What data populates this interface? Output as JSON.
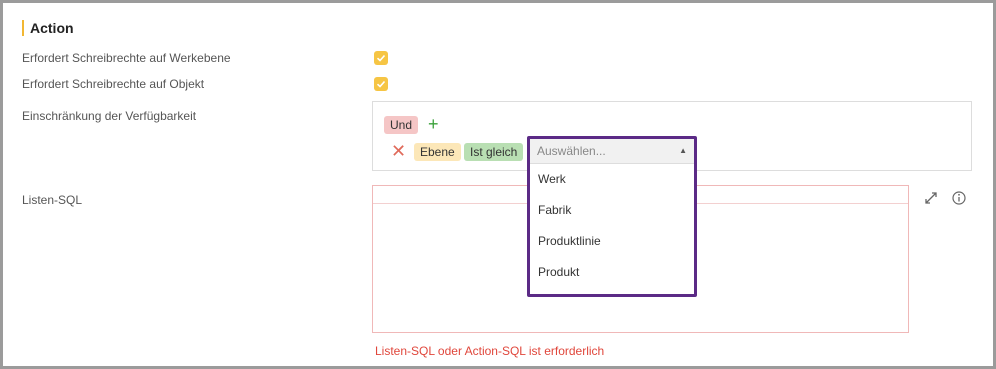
{
  "section": {
    "title": "Action"
  },
  "fields": {
    "write_level": {
      "label": "Erfordert Schreibrechte auf Werkebene",
      "checked": true
    },
    "write_object": {
      "label": "Erfordert Schreibrechte auf Objekt",
      "checked": true
    },
    "availability": {
      "label": "Einschränkung der Verfügbarkeit",
      "operator_tag": "Und",
      "condition": {
        "field_tag": "Ebene",
        "comparator_tag": "Ist gleich"
      },
      "select": {
        "placeholder": "Auswählen...",
        "options": [
          "Werk",
          "Fabrik",
          "Produktlinie",
          "Produkt"
        ]
      }
    },
    "list_sql": {
      "label": "Listen-SQL",
      "error": "Listen-SQL oder Action-SQL ist erforderlich"
    }
  },
  "icons": {
    "add": "plus-icon",
    "remove": "close-icon",
    "expand": "expand-icon",
    "info": "info-icon",
    "caret": "caret-up-icon"
  },
  "colors": {
    "accent": "#f6c544",
    "select_border": "#5b2a86",
    "error": "#e0463b"
  }
}
